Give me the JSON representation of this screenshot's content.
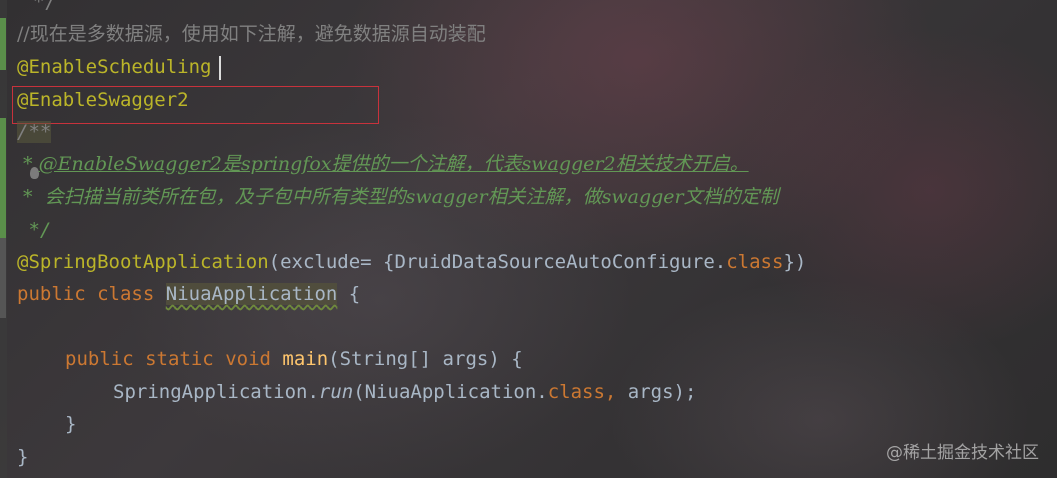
{
  "code": {
    "line0_comment": "*/",
    "line1_comment": "//现在是多数据源，使用如下注解，避免数据源自动装配",
    "line2_annotation": "@EnableScheduling",
    "line3_annotation": "@EnableSwagger2",
    "line4_doc_open": "/**",
    "line5_doc_star": " * ",
    "line5_doc_tag": "@EnableSwagger2是springfox提供的一个注解，代表swagger2相关技术开启。",
    "line6_doc": " *  会扫描当前类所在包，及子包中所有类型的swagger相关注解，做swagger文档的定制",
    "line7_doc_close": " */",
    "line8_annotation": "@SpringBootApplication",
    "line8_args_open": "(exclude= {DruidDataSourceAutoConfigure.",
    "line8_class_kw": "class",
    "line8_args_close": "})",
    "line9_public": "public",
    "line9_class": "class",
    "line9_name": "NiuaApplication",
    "line9_brace": " {",
    "line11_public": "public",
    "line11_static": "static",
    "line11_void": "void",
    "line11_method": "main",
    "line11_params": "(String[] args) {",
    "line12_receiver": "SpringApplication.",
    "line12_method": "run",
    "line12_args_open": "(NiuaApplication.",
    "line12_class_kw": "class",
    "line12_comma": ",",
    "line12_args_close": " args);",
    "line13_brace": "}",
    "line14_brace": "}"
  },
  "watermark": "@稀土掘金技术社区",
  "colors": {
    "keyword": "#cc7832",
    "annotation": "#bbb529",
    "comment": "#808080",
    "javadoc": "#629755",
    "method_decl": "#ffc66d",
    "plain": "#a9b7c6",
    "highlight_box": "#c8323c"
  }
}
